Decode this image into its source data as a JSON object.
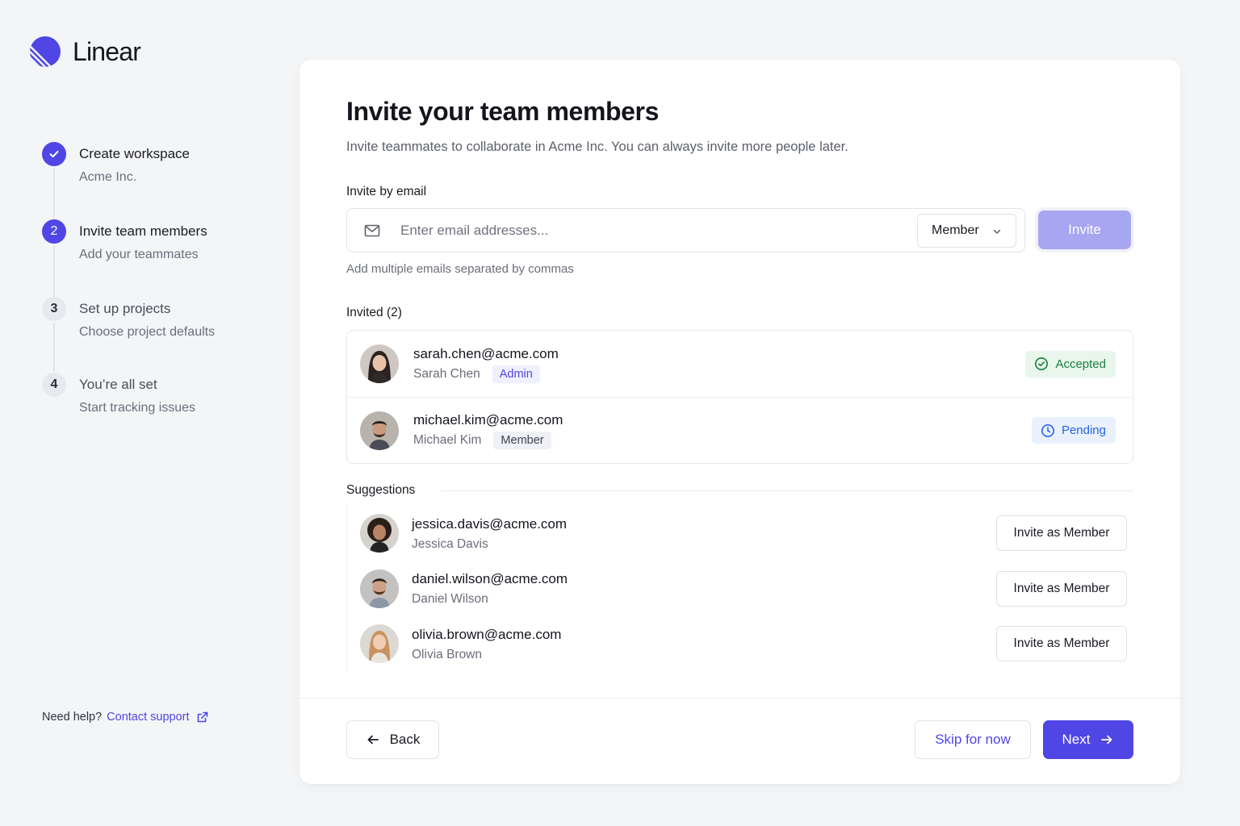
{
  "brand": {
    "name": "Linear",
    "logo_icon": "linear-logo-icon",
    "accent": "#4f46e5"
  },
  "steps": [
    {
      "number": "1",
      "title": "Create workspace",
      "subtitle": "Acme Inc.",
      "state": "done"
    },
    {
      "number": "2",
      "title": "Invite team members",
      "subtitle": "Add your teammates",
      "state": "active"
    },
    {
      "number": "3",
      "title": "Set up projects",
      "subtitle": "Choose project defaults",
      "state": "todo"
    },
    {
      "number": "4",
      "title": "You’re all set",
      "subtitle": "Start tracking issues",
      "state": "todo"
    }
  ],
  "help": {
    "prompt": "Need help?",
    "link": "Contact support",
    "icon": "external-link-icon"
  },
  "main": {
    "title": "Invite your team members",
    "subtitle": "Invite teammates to collaborate in Acme Inc. You can always invite more people later.",
    "invite_label": "Invite by email",
    "email_placeholder": "Enter email addresses...",
    "email_value": "",
    "role_selected": "Member",
    "invite_button": "Invite",
    "hint": "Add multiple emails separated by commas",
    "invited_label": "Invited (2)",
    "invited": [
      {
        "email": "sarah.chen@acme.com",
        "name": "Sarah Chen",
        "role": "Admin",
        "status": "Accepted",
        "status_color": "#17803d"
      },
      {
        "email": "michael.kim@acme.com",
        "name": "Michael Kim",
        "role": "Member",
        "status": "Pending",
        "status_color": "#2563eb"
      }
    ],
    "suggestions_label": "Suggestions",
    "suggestions": [
      {
        "email": "jessica.davis@acme.com",
        "name": "Jessica Davis",
        "action": "Invite as Member"
      },
      {
        "email": "daniel.wilson@acme.com",
        "name": "Daniel Wilson",
        "action": "Invite as Member"
      },
      {
        "email": "olivia.brown@acme.com",
        "name": "Olivia Brown",
        "action": "Invite as Member"
      }
    ]
  },
  "footer": {
    "back": "Back",
    "skip": "Skip for now",
    "next": "Next"
  }
}
